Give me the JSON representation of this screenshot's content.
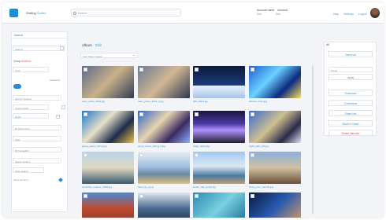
{
  "colors": {
    "accent": "#1b8fd6",
    "link": "#3aa0e0",
    "danger": "#e04747"
  },
  "header": {
    "brand_main": "Sorting",
    "brand_accent": "Sorted",
    "search_placeholder": "Search",
    "account_name": "Account name",
    "account_sub": "Sub",
    "account_name2": "Account",
    "account_sub2": "Sub",
    "links": [
      "Help",
      "Settings",
      "Logout"
    ]
  },
  "sidebar": {
    "title": "Search",
    "search_value": "Search",
    "section_label": "Group",
    "section_label_accent": "All items",
    "select1": "Type",
    "small_link": "Advanced",
    "field_sort": "Sort by: Newest",
    "field_a": "Custom field",
    "field_b": "Email",
    "field_c": "By Description",
    "field_d": "Date",
    "field_e": "By Uploading",
    "field_f": "Select location",
    "action": "Save search",
    "footer": "Show all items"
  },
  "main": {
    "title": "Album",
    "title_accent": "Edit",
    "sort_label": "Sort: Date created",
    "items": [
      {
        "caption": "team_photo_2019.jpg",
        "icon": "photo-icon"
      },
      {
        "caption": "team_photo_2019_b.jpg",
        "icon": "photo-icon"
      },
      {
        "caption": "IMG_0021.jpg",
        "icon": "photo-icon"
      },
      {
        "caption": "abstract_blue.jpg",
        "icon": "photo-icon"
      },
      {
        "caption": "group_event_spring.jpg",
        "icon": "photo-icon"
      },
      {
        "caption": "group_event_spring_2.jpg",
        "icon": "photo-icon"
      },
      {
        "caption": "stage_lights.jpg",
        "icon": "photo-icon"
      },
      {
        "caption": "night_party_03.jpg",
        "icon": "photo-icon"
      },
      {
        "caption": "workshop_outdoor_2018.jpg",
        "icon": "photo-icon"
      },
      {
        "caption": "field_trip_a.jpg",
        "icon": "photo-icon"
      },
      {
        "caption": "beach_day_group.jpg",
        "icon": "photo-icon"
      },
      {
        "caption": "hiking_tour_summit.jpg",
        "icon": "photo-icon"
      },
      {
        "caption": "building_front.jpg",
        "icon": "photo-icon"
      },
      {
        "caption": "conference_room.jpg",
        "icon": "photo-icon"
      },
      {
        "caption": "water_texture.jpg",
        "icon": "photo-icon"
      },
      {
        "caption": "night_portrait.jpg",
        "icon": "photo-icon"
      }
    ]
  },
  "rightpanel": {
    "title": "All",
    "btn_top": "Select all",
    "select": "Group",
    "btn_apply": "Apply",
    "btns": [
      "Download",
      "Collections",
      "Share link",
      "Move to folder"
    ],
    "btn_delete": "Delete selected"
  }
}
